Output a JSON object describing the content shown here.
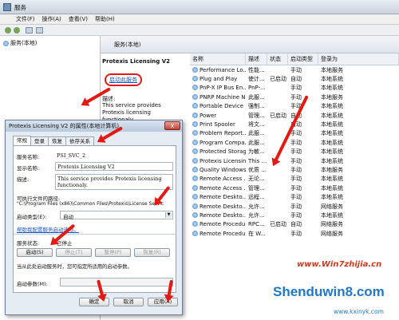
{
  "window": {
    "title": "服务"
  },
  "menu": [
    "文件(F)",
    "操作(A)",
    "查看(V)",
    "帮助(H)"
  ],
  "tree": {
    "root": "服务(本地)"
  },
  "detail": {
    "header": "服务(本地)",
    "service_name": "Protexis Licensing V2",
    "start_link": "启动此服务",
    "desc_label": "描述:",
    "desc_text": "This service provides Protexis licensing functionaly."
  },
  "list": {
    "headers": [
      "名称",
      "描述",
      "状态",
      "启动类型",
      "登录为"
    ],
    "rows": [
      [
        "Performance Lo...",
        "性能...",
        "",
        "手动",
        "本地服务"
      ],
      [
        "Plug and Play",
        "使计...",
        "已启动",
        "自动",
        "本地系统"
      ],
      [
        "PnP-X IP Bus En...",
        "PnP-...",
        "",
        "手动",
        "本地系统"
      ],
      [
        "PNRP Machine N...",
        "此服...",
        "",
        "手动",
        "本地服务"
      ],
      [
        "Portable Device ...",
        "强制...",
        "",
        "手动",
        "本地系统"
      ],
      [
        "Power",
        "管理...",
        "已启动",
        "自动",
        "本地系统"
      ],
      [
        "Print Spooler",
        "将文...",
        "",
        "自动",
        "本地系统"
      ],
      [
        "Problem Report...",
        "此服...",
        "",
        "手动",
        "本地系统"
      ],
      [
        "Program Compa...",
        "此服...",
        "",
        "手动",
        "本地系统"
      ],
      [
        "Protected Storage",
        "为敏...",
        "",
        "手动",
        "本地系统"
      ],
      [
        "Protexis Licensin...",
        "This ...",
        "",
        "手动",
        "本地系统"
      ],
      [
        "Quality Windows...",
        "优质 ...",
        "",
        "手动",
        "本地服务"
      ],
      [
        "Remote Access ...",
        "无论...",
        "",
        "手动",
        "本地系统"
      ],
      [
        "Remote Access ...",
        "管理...",
        "",
        "手动",
        "本地系统"
      ],
      [
        "Remote Deskto...",
        "远程...",
        "",
        "手动",
        "本地系统"
      ],
      [
        "Remote Deskto...",
        "允许...",
        "",
        "手动",
        "网络服务"
      ],
      [
        "Remote Deskto...",
        "允许...",
        "",
        "手动",
        "本地系统"
      ],
      [
        "Remote Procedu...",
        "RPC...",
        "已启动",
        "自动",
        "网络服务"
      ],
      [
        "Remote Procedu...",
        "在 W...",
        "",
        "手动",
        "网络服务"
      ]
    ]
  },
  "dialog": {
    "title": "Protexis Licensing V2 的属性(本地计算机)",
    "close": "x",
    "tabs": [
      "常规",
      "登录",
      "恢复",
      "依存关系"
    ],
    "svc_name_label": "服务名称:",
    "svc_name": "PSI_SVC_2",
    "display_label": "显示名称:",
    "display": "Protexis Licensing V2",
    "desc_label": "描述:",
    "desc": "This service provides Protexis licensing functionaly.",
    "exe_label": "可执行文件的路径:",
    "exe": "\"C:\\Program Files (x86)\\Common Files\\Protexis\\License Servic",
    "starttype_label": "启动类型(E):",
    "starttype": "自动",
    "help_link": "帮助我配置服务启动选项。",
    "status_label": "服务状态:",
    "status": "已停止",
    "btn_start": "启动(S)",
    "btn_stop": "停止(T)",
    "btn_pause": "暂停(P)",
    "btn_resume": "恢复(R)",
    "hint": "当从此处启动服务时，您可指定所适用的启动参数。",
    "param_label": "启动参数(M):",
    "ok": "确定",
    "cancel": "取消",
    "apply": "应用(A)"
  },
  "watermark": {
    "site1": "www.Win7zhijia.cn",
    "brand": "Shenduwin8.com",
    "site2": "www.kxinyk.com"
  }
}
